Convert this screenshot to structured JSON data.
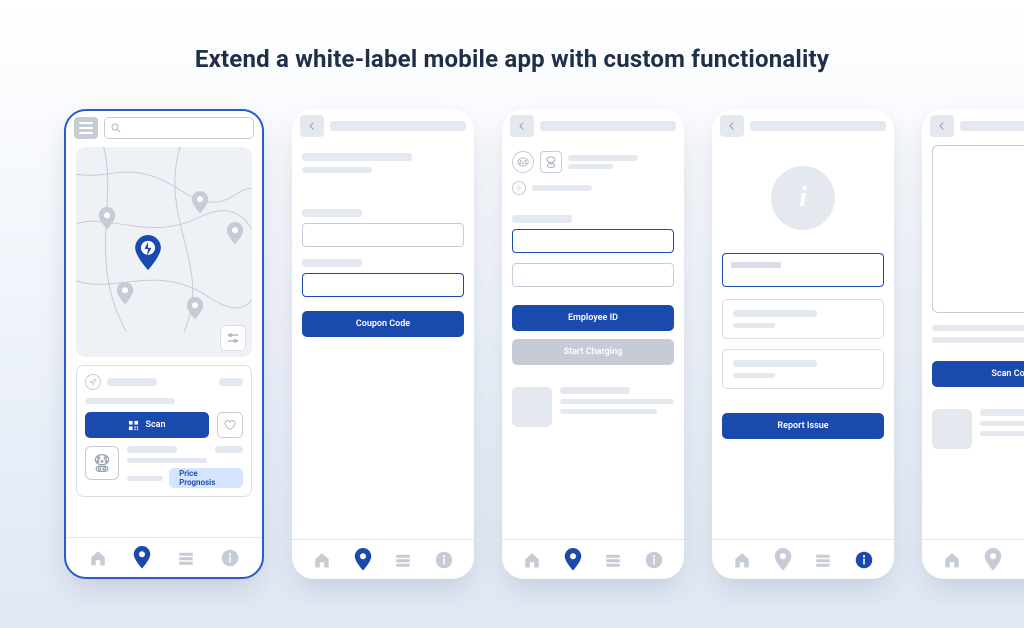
{
  "title": "Extend a white-label mobile app with custom functionality",
  "colors": {
    "primary": "#1a4aad",
    "accent": "#d5e5ff",
    "navy": "#1e2f47"
  },
  "phone1": {
    "menu_icon": "hamburger-icon",
    "search_icon": "magnifier-icon",
    "map_ctrl_icon": "sliders-icon",
    "scan_button": "Scan",
    "scan_icon": "qr-icon",
    "heart_icon": "heart-icon",
    "price_button": "Price Prognosis",
    "plug_icon": "ccs-plug-icon",
    "loc_icon": "nav-arrow-icon",
    "bolt_icon": "bolt-icon",
    "tabs": [
      "home",
      "pin",
      "list",
      "info"
    ],
    "active_tab": 1
  },
  "phone2": {
    "back_icon": "chevron-left-icon",
    "coupon_button": "Coupon Code",
    "tabs": [
      "home",
      "pin",
      "list",
      "info"
    ],
    "active_tab": 1
  },
  "phone3": {
    "back_icon": "chevron-left-icon",
    "plug1_icon": "type2-plug-icon",
    "plug2_icon": "ccs-plug-icon",
    "bolt_icon": "bolt-icon",
    "employee_button": "Employee ID",
    "start_button": "Start Charging",
    "tabs": [
      "home",
      "pin",
      "list",
      "info"
    ],
    "active_tab": 1
  },
  "phone4": {
    "back_icon": "chevron-left-icon",
    "info_icon": "info-icon",
    "info_glyph": "i",
    "report_button": "Report Issue",
    "tabs": [
      "home",
      "pin",
      "list",
      "info"
    ],
    "active_tab": 3
  },
  "phone5": {
    "back_icon": "chevron-left-icon",
    "scan_button": "Scan Code",
    "tabs": [
      "home",
      "pin",
      "list",
      "info"
    ],
    "active_tab": 2
  },
  "icons": {
    "home": "home-icon",
    "pin": "pin-icon",
    "list": "list-icon",
    "info": "info-icon"
  }
}
